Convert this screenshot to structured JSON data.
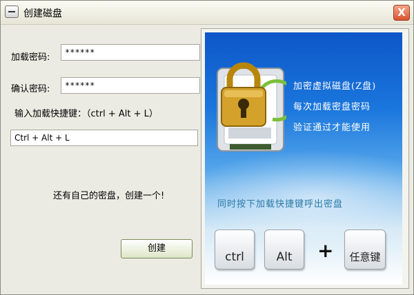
{
  "window": {
    "title": "创建磁盘",
    "close_label": "X"
  },
  "form": {
    "load_password_label": "加载密码:",
    "load_password_value": "******",
    "confirm_password_label": "确认密码:",
    "confirm_password_value": "******",
    "hotkey_label": "输入加载快捷键：（ctrl + Alt + L）",
    "hotkey_value": "Ctrl + Alt + L",
    "no_disk_text": "还有自己的密盘，创建一个!",
    "create_button": "创建"
  },
  "panel": {
    "line1": "加密虚拟磁盘(Z盘)",
    "line2": "每次加载密盘密码",
    "line3": "验证通过才能使用",
    "hint": "同时按下加载快捷键呼出密盘",
    "keys": {
      "ctrl": "ctrl",
      "alt": "Alt",
      "plus": "+",
      "any": "任意键"
    }
  }
}
